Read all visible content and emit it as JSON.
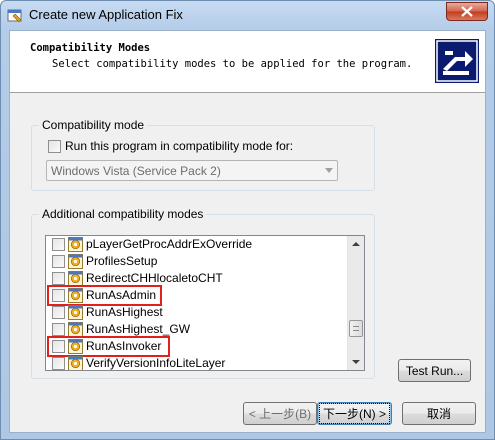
{
  "window": {
    "title": "Create new Application Fix"
  },
  "header": {
    "title": "Compatibility Modes",
    "subtitle": "Select compatibility modes to be applied for the program."
  },
  "compat_group": {
    "label": "Compatibility mode",
    "checkbox_label": "Run this program in compatibility mode for:",
    "checked": false,
    "selected_os": "Windows Vista (Service Pack 2)"
  },
  "additional_group": {
    "label": "Additional compatibility modes",
    "items": [
      {
        "label": "pLayerGetProcAddrExOverride",
        "checked": false,
        "highlighted": false
      },
      {
        "label": "ProfilesSetup",
        "checked": false,
        "highlighted": false
      },
      {
        "label": "RedirectCHHlocaletoCHT",
        "checked": false,
        "highlighted": false
      },
      {
        "label": "RunAsAdmin",
        "checked": false,
        "highlighted": true
      },
      {
        "label": "RunAsHighest",
        "checked": false,
        "highlighted": false
      },
      {
        "label": "RunAsHighest_GW",
        "checked": false,
        "highlighted": false
      },
      {
        "label": "RunAsInvoker",
        "checked": false,
        "highlighted": true
      },
      {
        "label": "VerifyVersionInfoLiteLayer",
        "checked": false,
        "highlighted": false
      }
    ],
    "test_run_label": "Test Run..."
  },
  "footer": {
    "back_label": "< 上一步(B)",
    "next_label": "下一步(N) >",
    "cancel_label": "取消"
  },
  "colors": {
    "highlight_border": "#e0201c",
    "close_button": "#c33b1e"
  },
  "icons": {
    "title": "app-fix-icon",
    "header": "compat-wizard-icon",
    "item": "compat-fix-icon",
    "close": "close-icon"
  }
}
